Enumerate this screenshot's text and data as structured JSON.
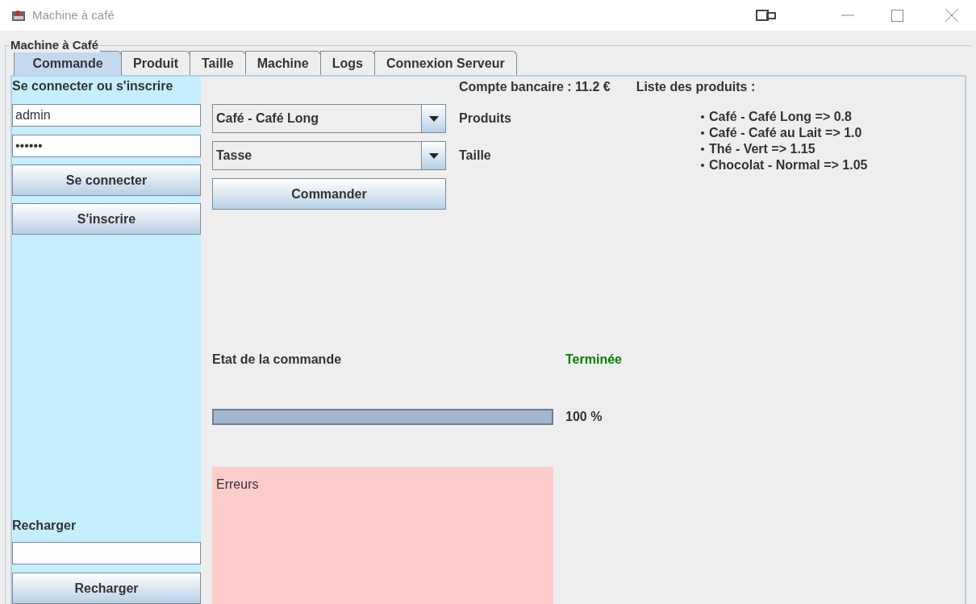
{
  "window": {
    "title": "Machine à café"
  },
  "group_title": "Machine à Café",
  "tabs": [
    {
      "label": "Commande",
      "selected": true
    },
    {
      "label": "Produit",
      "selected": false
    },
    {
      "label": "Taille",
      "selected": false
    },
    {
      "label": "Machine",
      "selected": false
    },
    {
      "label": "Logs",
      "selected": false
    },
    {
      "label": "Connexion Serveur",
      "selected": false
    }
  ],
  "login": {
    "heading": "Se connecter ou s'inscrire",
    "username": "admin",
    "password": "••••••",
    "buttons": [
      "Se connecter",
      "S'inscrire"
    ]
  },
  "recharge": {
    "heading": "Recharger",
    "button": "Recharger"
  },
  "order": {
    "product": {
      "value": "Café - Café Long",
      "label": "Produits"
    },
    "size": {
      "value": "Tasse",
      "label": "Taille"
    },
    "button": "Commander"
  },
  "account": "Compte bancaire : 11.2 €",
  "products": {
    "heading": "Liste des produits :",
    "items": [
      "Café - Café Long => 0.8",
      "Café - Café au Lait => 1.0",
      "Thé - Vert => 1.15",
      "Chocolat - Normal => 1.05"
    ]
  },
  "status": {
    "label": "Etat de la commande",
    "value": "Terminée",
    "color": "#008000"
  },
  "progress": {
    "level": 1,
    "reading": "100 %"
  },
  "errors": {
    "text": "Erreurs"
  }
}
